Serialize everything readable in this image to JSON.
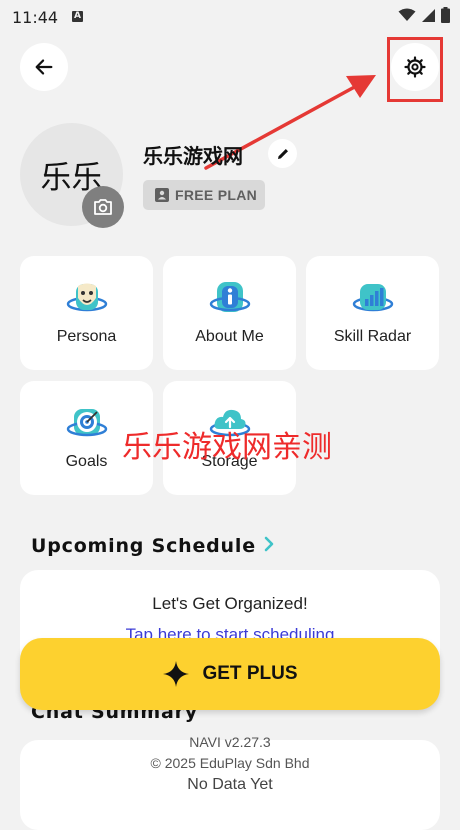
{
  "status_bar": {
    "time": "11:44",
    "notification_icon": "a-icon",
    "wifi_icon": "wifi-icon",
    "signal_icon": "signal-icon",
    "battery_icon": "battery-icon"
  },
  "header": {
    "back_icon": "arrow-left-icon",
    "settings_icon": "gear-icon"
  },
  "profile": {
    "avatar_text": "乐乐",
    "username": "乐乐游戏网",
    "plan": "FREE PLAN",
    "camera_icon": "camera-icon",
    "edit_icon": "pencil-icon",
    "plan_icon": "id-badge-icon"
  },
  "tiles": [
    {
      "label": "Persona",
      "icon": "mask-icon"
    },
    {
      "label": "About Me",
      "icon": "info-icon"
    },
    {
      "label": "Skill Radar",
      "icon": "bar-chart-icon"
    },
    {
      "label": "Goals",
      "icon": "target-icon"
    },
    {
      "label": "Storage",
      "icon": "cloud-icon"
    }
  ],
  "watermark": "乐乐游戏网亲测",
  "schedule": {
    "title": "Upcoming Schedule",
    "card_title": "Let's Get Organized!",
    "card_link": "Tap here to start scheduling"
  },
  "chat_summary": {
    "title": "Chat Summary",
    "empty": "No Data Yet"
  },
  "get_plus": {
    "label": "GET PLUS",
    "icon": "sparkle-icon"
  },
  "footer": {
    "version": "NAVI v2.27.3",
    "copyright": "© 2025 EduPlay Sdn Bhd"
  },
  "colors": {
    "background": "#f2f2f2",
    "accent_yellow": "#fdd12f",
    "link_blue": "#3b3bd6",
    "highlight_red": "#e53935",
    "icon_teal": "#3fc3c8",
    "icon_blue": "#2f7fd6"
  }
}
